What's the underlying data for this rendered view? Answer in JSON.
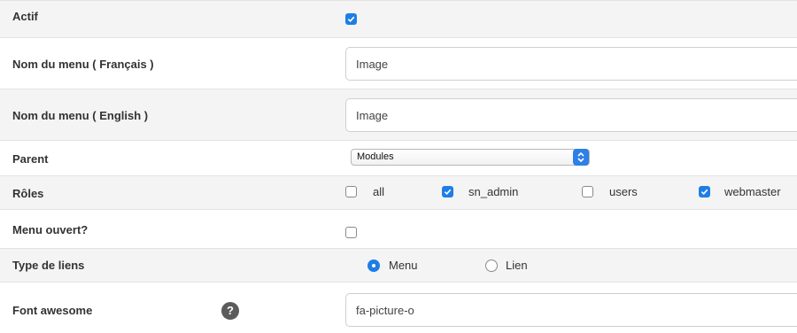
{
  "fields": {
    "actif": {
      "label": "Actif",
      "checked": true
    },
    "nom_fr": {
      "label": "Nom du menu ( Français )",
      "value": "Image",
      "placeholder": ""
    },
    "nom_en": {
      "label": "Nom du menu ( English )",
      "value": "Image",
      "placeholder": ""
    },
    "parent": {
      "label": "Parent",
      "selected": "Modules"
    },
    "roles": {
      "label": "Rôles",
      "options": [
        {
          "label": "all",
          "checked": false
        },
        {
          "label": "sn_admin",
          "checked": true
        },
        {
          "label": "users",
          "checked": false
        },
        {
          "label": "webmaster",
          "checked": true
        }
      ]
    },
    "menu_ouvert": {
      "label": "Menu ouvert?",
      "checked": false
    },
    "type_liens": {
      "label": "Type de liens",
      "options": [
        {
          "label": "Menu",
          "selected": true
        },
        {
          "label": "Lien",
          "selected": false
        }
      ]
    },
    "font_awesome": {
      "label": "Font awesome",
      "value": "fa-picture-o",
      "help_symbol": "?"
    }
  },
  "colors": {
    "accent": "#1e7ee5",
    "stripe": "#f4f4f4",
    "border": "#e3e3e3"
  },
  "icons": {
    "check": "checkmark-icon",
    "help": "help-icon",
    "select_arrows": "chevron-updown-icon"
  }
}
